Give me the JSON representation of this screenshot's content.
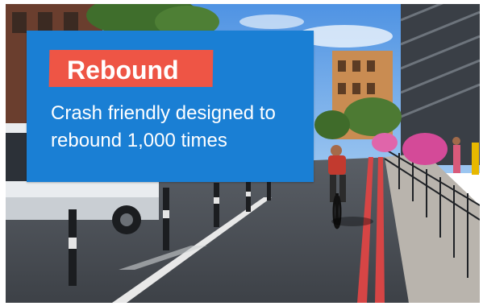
{
  "banner": {
    "title": "Rebound",
    "description": "Crash friendly designed to rebound 1,000 times",
    "background_color": "#1a7fd4",
    "tag_color": "#ee5545",
    "text_color": "#ffffff"
  },
  "photo": {
    "subject": "urban cycle lane with bollards, van and cyclist"
  }
}
